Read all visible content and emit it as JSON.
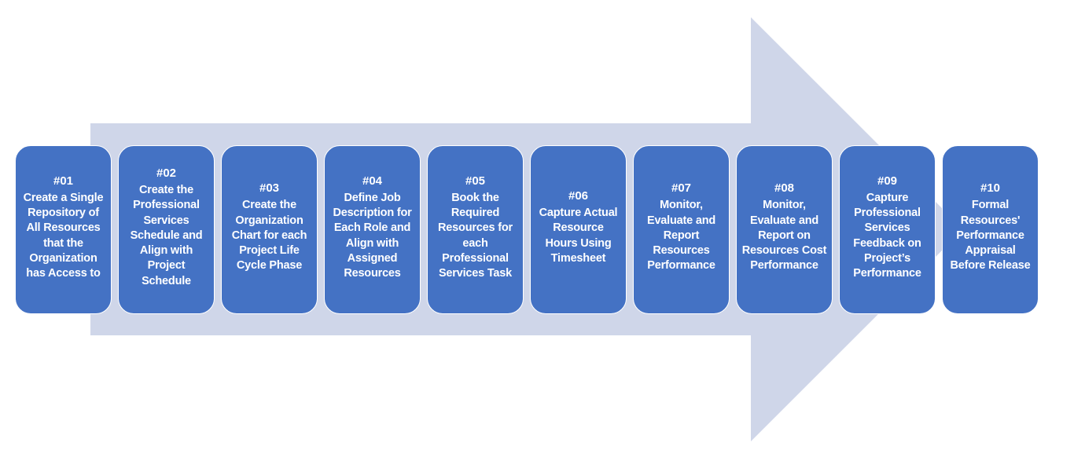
{
  "diagram": {
    "type": "process-arrow",
    "colors": {
      "arrow_fill": "#cfd6e9",
      "step_fill": "#4472c4",
      "step_border": "#ffffff",
      "step_text": "#ffffff"
    },
    "steps": [
      {
        "number": "#01",
        "text": "Create a Single Repository of All Resources that the Organization has Access to"
      },
      {
        "number": "#02",
        "text": "Create the Professional Services Schedule and Align with Project Schedule"
      },
      {
        "number": "#03",
        "text": "Create the Organization Chart for each Project Life Cycle Phase"
      },
      {
        "number": "#04",
        "text": "Define Job Description for Each Role and Align with Assigned Resources"
      },
      {
        "number": "#05",
        "text": "Book the Required Resources for each Professional Services Task"
      },
      {
        "number": "#06",
        "text": "Capture Actual Resource Hours Using Timesheet"
      },
      {
        "number": "#07",
        "text": "Monitor, Evaluate and Report Resources Performance"
      },
      {
        "number": "#08",
        "text": "Monitor, Evaluate and Report on Resources Cost Performance"
      },
      {
        "number": "#09",
        "text": "Capture Professional Services Feedback on Project’s Performance"
      },
      {
        "number": "#10",
        "text": "Formal Resources' Performance Appraisal Before Release"
      }
    ]
  }
}
